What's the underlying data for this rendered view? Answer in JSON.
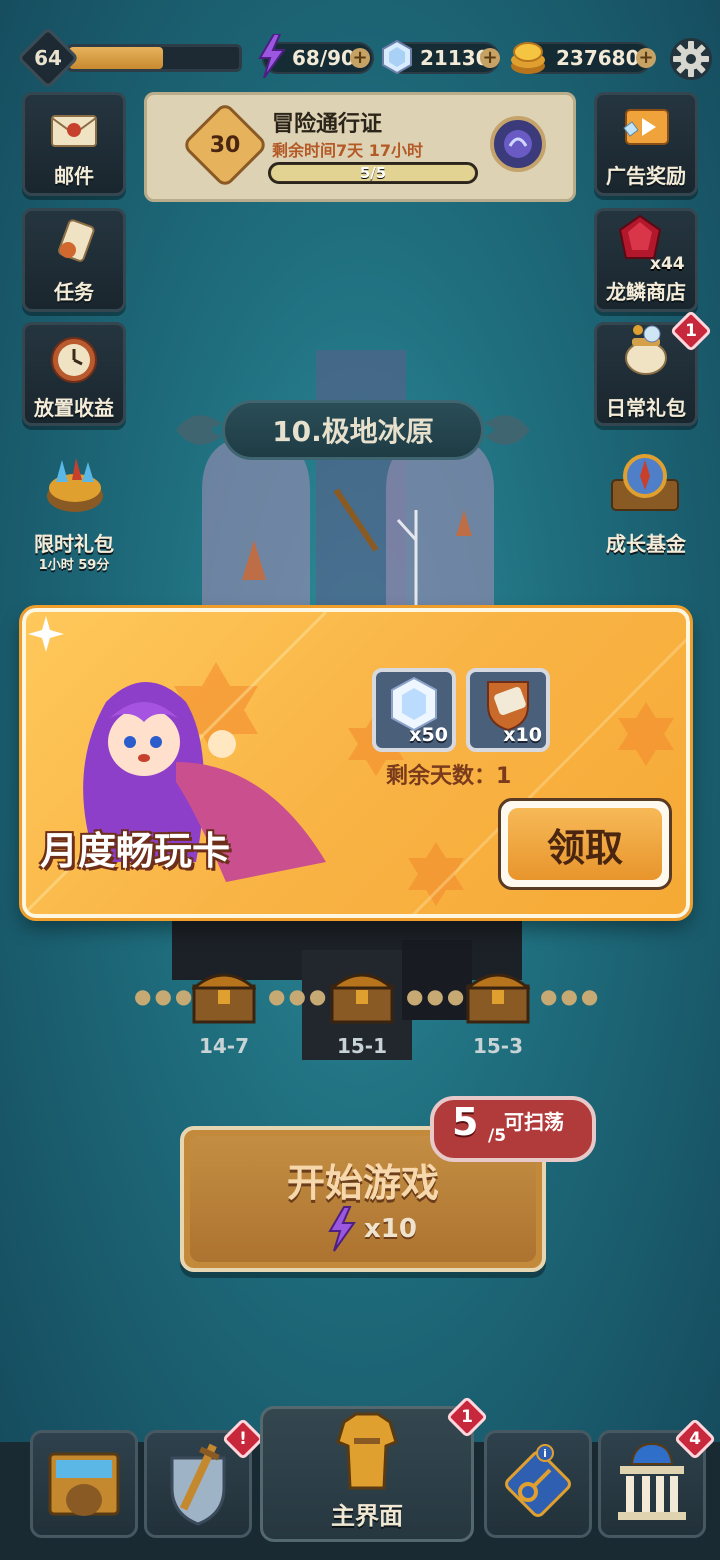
{
  "player": {
    "level": "64",
    "xp_fraction": 0.55
  },
  "resources": {
    "energy": "68/90",
    "gems": "21130",
    "coins": "237680"
  },
  "left_menu": [
    {
      "label": "邮件",
      "icon": "mail-icon"
    },
    {
      "label": "任务",
      "icon": "scroll-icon"
    },
    {
      "label": "放置收益",
      "icon": "clock-icon"
    },
    {
      "label": "限时礼包",
      "sub": "1小时 59分",
      "icon": "treasure-icon"
    }
  ],
  "right_menu": [
    {
      "label": "广告奖励",
      "icon": "tv-icon"
    },
    {
      "label": "龙鳞商店",
      "qty": "x44",
      "icon": "ruby-icon"
    },
    {
      "label": "日常礼包",
      "badge": "1",
      "icon": "pot-icon"
    },
    {
      "label": "成长基金",
      "icon": "medal-icon"
    }
  ],
  "pass": {
    "level": "30",
    "title": "冒险通行证",
    "time_left": "剩余时间7天 17小时",
    "progress": "5/5",
    "progress_fraction": 1.0
  },
  "stage": {
    "name": "10.极地冰原"
  },
  "modal": {
    "title": "月度畅玩卡",
    "rewards": [
      {
        "icon": "diamond-icon",
        "qty": "x50"
      },
      {
        "icon": "shield-scroll-icon",
        "qty": "x10"
      }
    ],
    "days_left": "剩余天数：1",
    "claim_label": "领取"
  },
  "chests": [
    {
      "label": "14-7"
    },
    {
      "label": "15-1"
    },
    {
      "label": "15-3"
    }
  ],
  "start": {
    "label": "开始游戏",
    "cost": "x10",
    "sweep_count": "5",
    "sweep_total": "/5",
    "sweep_label": "可扫荡"
  },
  "nav": {
    "main_label": "主界面",
    "main_badge": "1",
    "badge_sword": "!",
    "badge_bank": "4",
    "badge_key": "i"
  },
  "colors": {
    "background": "#1f6e7e",
    "modal": "#f9b446",
    "claim": "#e8952c",
    "badge": "#c8283c"
  }
}
